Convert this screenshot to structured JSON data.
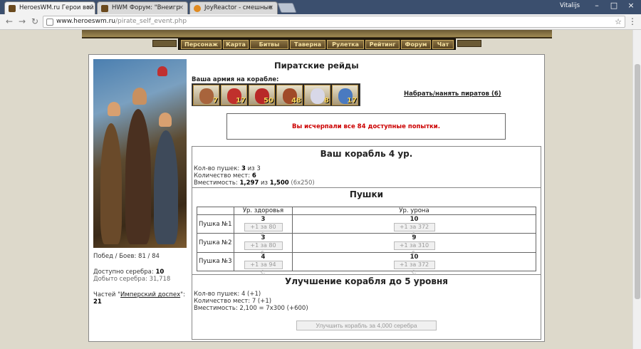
{
  "browser": {
    "tabs": [
      {
        "title": "HeroesWM.ru Герои вой",
        "active": true
      },
      {
        "title": "HWM Форум: \"Внеигр",
        "active": false
      },
      {
        "title": "JoyReactor - смешные",
        "active": false
      }
    ],
    "user": "Vitalijs",
    "url_host": "www.heroeswm.ru",
    "url_path": "/pirate_self_event.php"
  },
  "nav": [
    "Персонаж",
    "Карта",
    "Битвы",
    "Таверна",
    "Рулетка",
    "Рейтинг",
    "Форум",
    "Чат"
  ],
  "page": {
    "title": "Пиратские рейды",
    "army_label": "Ваша армия на корабле:",
    "army": [
      {
        "count": "7",
        "color": "#a8643c"
      },
      {
        "count": "17",
        "color": "#c0302c"
      },
      {
        "count": "50",
        "color": "#b82828"
      },
      {
        "count": "48",
        "color": "#a04a28"
      },
      {
        "count": "8",
        "color": "#d8d8e8"
      },
      {
        "count": "17",
        "color": "#4a7ac0"
      }
    ],
    "hire_link": "Набрать/нанять пиратов (6)",
    "alert": "Вы исчерпали все 84 доступные попытки.",
    "stats": {
      "wins_label": "Побед / Боев: 81 / 84",
      "silver_label": "Доступно серебра: ",
      "silver_value": "10",
      "mined_label": "Добыто серебра: 31,718",
      "parts_prefix": "Частей \"",
      "parts_link": "Имперский доспех",
      "parts_suffix": "\":",
      "parts_value": "21"
    },
    "ship": {
      "title": "Ваш корабль 4 ур.",
      "cannons_label": "Кол-во пушек: ",
      "cannons_value": "3",
      "cannons_of": " из 3",
      "places_label": "Количество мест: ",
      "places_value": "6",
      "capacity_label": "Вместимость: ",
      "capacity_value": "1,297",
      "capacity_of": " из ",
      "capacity_max": "1,500",
      "capacity_note": " (6x250)"
    },
    "guns": {
      "title": "Пушки",
      "col_health": "Ур. здоровья",
      "col_damage": "Ур. урона",
      "rows": [
        {
          "name": "Пушка №1",
          "health": "3",
          "health_btn": "+1 за 80 с.",
          "damage": "10",
          "damage_btn": "+1 за 372 с."
        },
        {
          "name": "Пушка №2",
          "health": "3",
          "health_btn": "+1 за 80 с.",
          "damage": "9",
          "damage_btn": "+1 за 310 с."
        },
        {
          "name": "Пушка №3",
          "health": "4",
          "health_btn": "+1 за 94 с.",
          "damage": "10",
          "damage_btn": "+1 за 372 с."
        }
      ]
    },
    "upgrade": {
      "title": "Улучшение корабля до 5 уровня",
      "cannons": "Кол-во пушек: 4 (+1)",
      "places": "Количество мест: 7 (+1)",
      "capacity": "Вместимость: 2,100 = 7x300 (+600)",
      "button": "Улучшить корабль за 4,000 серебра"
    }
  }
}
